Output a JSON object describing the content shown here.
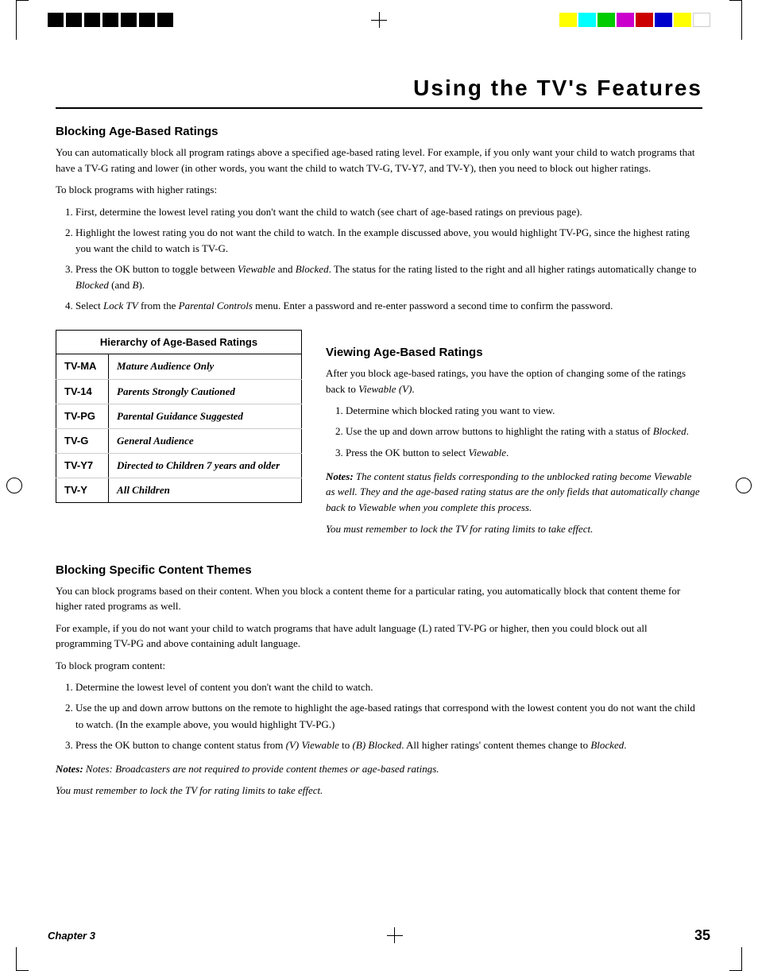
{
  "page": {
    "title": "Using the TV's Features",
    "chapter": "Chapter 3",
    "page_number": "35"
  },
  "sections": {
    "blocking_age": {
      "heading": "Blocking Age-Based Ratings",
      "intro1": "You can automatically block all program ratings above a specified age-based rating level. For example, if you only want your child to watch programs that have a TV-G rating and lower (in other words, you want the child to watch TV-G, TV-Y7, and TV-Y), then you need to block out higher ratings.",
      "intro2": "To block programs with higher ratings:",
      "steps": [
        "First, determine the lowest level rating you don't want the child to watch (see chart of age-based ratings on previous page).",
        "Highlight the lowest rating you do not want the child to watch. In the example discussed above, you would highlight TV-PG, since the highest rating you want the child to watch is TV-G.",
        "Press the OK button to toggle between Viewable and Blocked. The status for the rating listed to the right and all higher ratings automatically change to Blocked (and B).",
        "Select Lock TV from the Parental Controls menu. Enter a password and re-enter password a second time to confirm the password."
      ]
    },
    "table": {
      "title": "Hierarchy of Age-Based Ratings",
      "rows": [
        {
          "rating": "TV-MA",
          "description": "Mature Audience Only"
        },
        {
          "rating": "TV-14",
          "description": "Parents Strongly Cautioned"
        },
        {
          "rating": "TV-PG",
          "description": "Parental Guidance Suggested"
        },
        {
          "rating": "TV-G",
          "description": "General Audience"
        },
        {
          "rating": "TV-Y7",
          "description": "Directed to Children 7 years and older"
        },
        {
          "rating": "TV-Y",
          "description": "All Children"
        }
      ]
    },
    "viewing_age": {
      "heading": "Viewing Age-Based Ratings",
      "intro": "After you block age-based ratings, you have the option of changing some of the ratings back to Viewable (V).",
      "steps": [
        "Determine which blocked rating you want to view.",
        "Use the up and down arrow buttons to highlight the rating with a status of Blocked.",
        "Press the OK button to select Viewable."
      ],
      "notes1": "Notes: The content status fields corresponding to the unblocked rating become Viewable as well. They and the age-based rating status are the only fields that automatically change back to Viewable when you complete this process.",
      "notes2": "You must remember to lock the TV for rating limits to take effect."
    },
    "blocking_content": {
      "heading": "Blocking Specific Content Themes",
      "intro1": "You can block programs based on their content. When you block a content theme for a particular rating, you automatically block that content theme for higher rated programs as well.",
      "intro2": "For example, if you do not want your child to watch programs that have adult language (L) rated TV-PG or higher, then you could block out all programming TV-PG and above containing adult language.",
      "intro3": "To block program content:",
      "steps": [
        "Determine the lowest level of content you don't want the child to watch.",
        "Use the up and down arrow buttons on the remote to highlight the age-based ratings that correspond with the lowest content you do not want the child to watch. (In the example above, you would highlight TV-PG.)",
        "Press the OK button to change content status from (V) Viewable to (B) Blocked. All higher ratings' content themes change to Blocked."
      ],
      "notes1": "Notes:  Broadcasters are not required to provide content themes or age-based ratings.",
      "notes2": "You must remember to lock the TV for rating limits to take effect."
    }
  },
  "colors": {
    "color_bars": [
      "#ffff00",
      "#00ffff",
      "#00ff00",
      "#ff00ff",
      "#ff0000",
      "#0000ff",
      "#ffff00",
      "#ffffff"
    ]
  }
}
